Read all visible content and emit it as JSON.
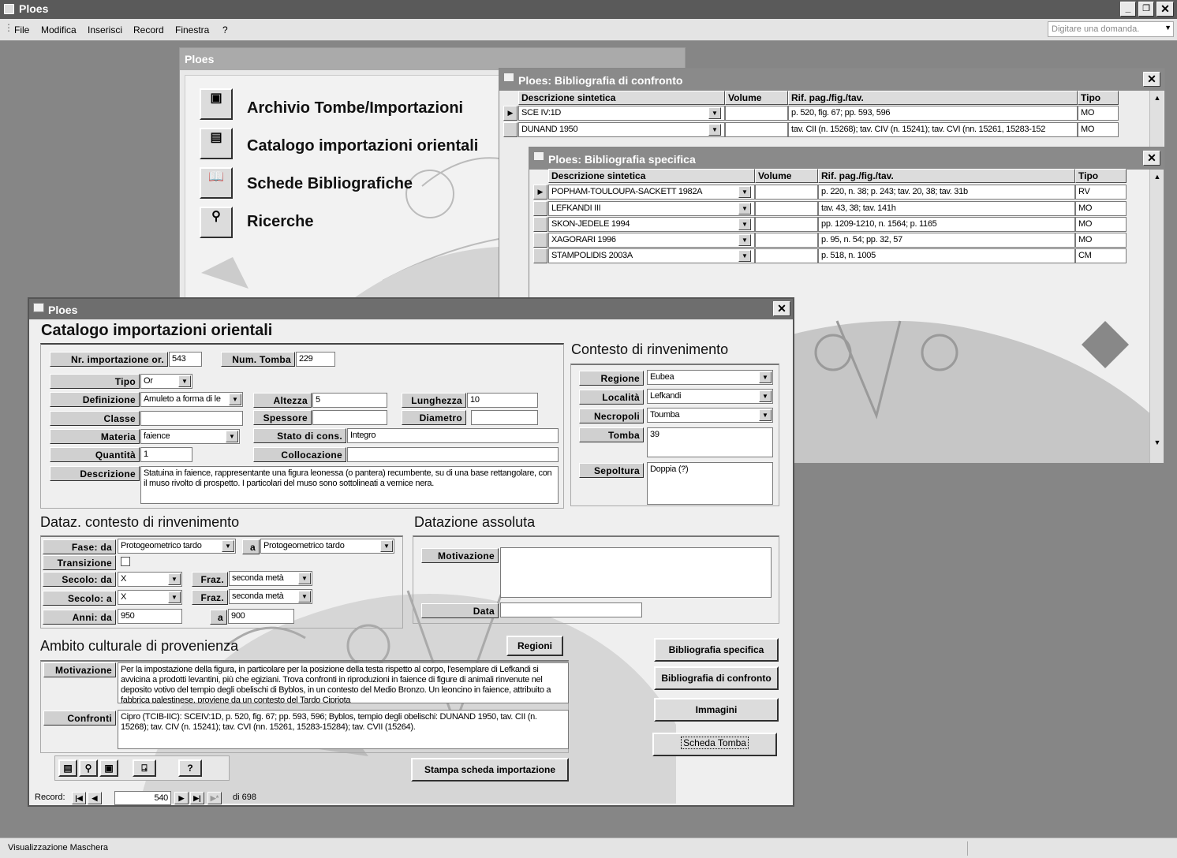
{
  "app": {
    "title": "Ploes",
    "status": "Visualizzazione Maschera",
    "help_placeholder": "Digitare una domanda."
  },
  "menu": [
    "File",
    "Modifica",
    "Inserisci",
    "Record",
    "Finestra",
    "?"
  ],
  "switchboard": {
    "title": "Ploes",
    "items": [
      {
        "label": "Archivio Tombe/Importazioni",
        "icon": "archive-icon"
      },
      {
        "label": "Catalogo importazioni orientali",
        "icon": "catalog-icon"
      },
      {
        "label": "Schede Bibliografiche",
        "icon": "book-icon"
      },
      {
        "label": "Ricerche",
        "icon": "binoculars-icon"
      }
    ]
  },
  "bib_confronto": {
    "title": "Ploes: Bibliografia di confronto",
    "headers": [
      "Descrizione sintetica",
      "Volume",
      "Rif. pag./fig./tav.",
      "Tipo"
    ],
    "rows": [
      {
        "desc": "SCE IV:1D",
        "vol": "",
        "rif": "p. 520, fig. 67;  pp. 593, 596",
        "tipo": "MO"
      },
      {
        "desc": "DUNAND 1950",
        "vol": "",
        "rif": "tav. CII (n. 15268); tav. CIV (n. 15241); tav. CVI (nn. 15261, 15283-152",
        "tipo": "MO"
      }
    ]
  },
  "bib_specifica": {
    "title": "Ploes: Bibliografia specifica",
    "headers": [
      "Descrizione sintetica",
      "Volume",
      "Rif. pag./fig./tav.",
      "Tipo"
    ],
    "rows": [
      {
        "desc": "POPHAM-TOULOUPA-SACKETT 1982A",
        "vol": "",
        "rif": "p. 220, n. 38; p. 243; tav. 20, 38; tav. 31b",
        "tipo": "RV"
      },
      {
        "desc": "LEFKANDI III",
        "vol": "",
        "rif": "tav. 43, 38; tav. 141h",
        "tipo": "MO"
      },
      {
        "desc": "SKON-JEDELE 1994",
        "vol": "",
        "rif": "pp. 1209-1210, n. 1564; p. 1165",
        "tipo": "MO"
      },
      {
        "desc": "XAGORARI 1996",
        "vol": "",
        "rif": "p. 95, n. 54; pp. 32, 57",
        "tipo": "MO"
      },
      {
        "desc": "STAMPOLIDIS 2003A",
        "vol": "",
        "rif": "p. 518, n. 1005",
        "tipo": "CM"
      }
    ]
  },
  "form": {
    "window_title": "Ploes",
    "title": "Catalogo importazioni orientali",
    "labels": {
      "nr": "Nr. importazione or.",
      "tomba_num": "Num. Tomba",
      "tipo": "Tipo",
      "definizione": "Definizione",
      "classe": "Classe",
      "materia": "Materia",
      "quantita": "Quantità",
      "descrizione": "Descrizione",
      "altezza": "Altezza",
      "lunghezza": "Lunghezza",
      "spessore": "Spessore",
      "diametro": "Diametro",
      "stato": "Stato di cons.",
      "collocazione": "Collocazione",
      "regione": "Regione",
      "localita": "Località",
      "necropoli": "Necropoli",
      "tomba": "Tomba",
      "sepoltura": "Sepoltura",
      "fase_da": "Fase: da",
      "fase_a": "a",
      "transizione": "Transizione",
      "secolo_da": "Secolo: da",
      "secolo_a": "Secolo: a",
      "fraz": "Fraz.",
      "anni_da": "Anni: da",
      "anni_a": "a",
      "motivazione": "Motivazione",
      "data": "Data",
      "confronti": "Confronti"
    },
    "values": {
      "nr": "543",
      "tomba_num": "229",
      "tipo": "Or",
      "definizione": "Amuleto a forma di le",
      "classe": "",
      "materia": "faience",
      "quantita": "1",
      "descrizione": "Statuina in faience, rappresentante una figura leonessa (o pantera) recumbente, su di una base rettangolare, con il muso rivolto di prospetto. I particolari del muso sono sottolineati a vernice nera.",
      "altezza": "5",
      "lunghezza": "10",
      "spessore": "",
      "diametro": "",
      "stato": "Integro",
      "collocazione": "",
      "regione": "Eubea",
      "localita": "Lefkandi",
      "necropoli": "Toumba",
      "tomba": "39",
      "sepoltura": "Doppia (?)",
      "fase_da": "Protogeometrico tardo",
      "fase_a": "Protogeometrico tardo",
      "secolo_da": "X",
      "fraz_da": "seconda metà",
      "secolo_a": "X",
      "fraz_a": "seconda metà",
      "anni_da": "950",
      "anni_a": "900",
      "motivazione_abs": "",
      "data_abs": "",
      "motivazione_cult": "Per la impostazione della figura, in particolare per la posizione della testa rispetto al corpo, l'esemplare di Lefkandi si avvicina a prodotti levantini, più che egiziani. Trova confronti in riproduzioni in faience di figure di animali rinvenute nel deposito votivo del tempio degli obelischi di Byblos, in un contesto del Medio Bronzo. Un leoncino in faience, attribuito a fabbrica palestinese, proviene da un contesto del Tardo Cipriota",
      "confronti": "Cipro (TCIB-IIC): SCEIV:1D, p. 520, fig. 67;  pp. 593, 596; Byblos, tempio degli obelischi: DUNAND 1950, tav. CII (n. 15268); tav. CIV (n. 15241); tav. CVI (nn. 15261, 15283-15284); tav. CVII (15264)."
    },
    "sections": {
      "contesto": "Contesto di rinvenimento",
      "dataz": "Dataz. contesto di rinvenimento",
      "assoluta": "Datazione assoluta",
      "ambito": "Ambito culturale di provenienza"
    },
    "buttons": {
      "regioni": "Regioni",
      "bib_spec": "Bibliografia specifica",
      "bib_conf": "Bibliografia di confronto",
      "immagini": "Immagini",
      "scheda_tomba": "Scheda Tomba",
      "stampa": "Stampa scheda importazione"
    },
    "record": {
      "label": "Record:",
      "current": "540",
      "total": "di 698"
    }
  }
}
